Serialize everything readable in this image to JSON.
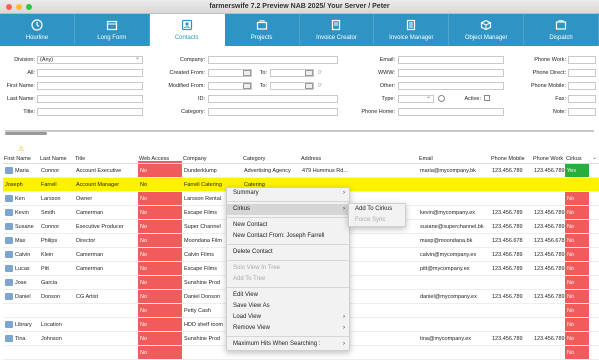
{
  "window": {
    "title": "farmerswife 7.2  Preview NAB 2025/ Your Server / Peter"
  },
  "toolbar": [
    {
      "label": "Hourline",
      "icon": "clock-icon",
      "active": false
    },
    {
      "label": "Long Form",
      "icon": "calendar-icon",
      "active": false
    },
    {
      "label": "Contacts",
      "icon": "contacts-icon",
      "active": true
    },
    {
      "label": "Projects",
      "icon": "briefcase-icon",
      "active": false
    },
    {
      "label": "Invoice Creator",
      "icon": "invoice-icon",
      "active": false
    },
    {
      "label": "Invoice Manager",
      "icon": "invoice-list-icon",
      "active": false
    },
    {
      "label": "Object Manager",
      "icon": "cube-icon",
      "active": false
    },
    {
      "label": "Dispatch",
      "icon": "dispatch-icon",
      "active": false
    }
  ],
  "search": {
    "division_label": "Division:",
    "division_value": "(Any)",
    "all_label": "All:",
    "firstname_label": "First Name:",
    "lastname_label": "Last Name:",
    "title_label": "Title:",
    "company_label": "Company:",
    "created_from_label": "Created From:",
    "to_label": "To:",
    "modified_from_label": "Modified From:",
    "id_label": "ID:",
    "category_label": "Category:",
    "email_label": "Email:",
    "www_label": "WWW:",
    "other_label": "Other:",
    "type_label": "Type:",
    "active_label": "Active:",
    "phone_home_label": "Phone Home:",
    "phone_work_label": "Phone Work:",
    "phone_direct_label": "Phone Direct:",
    "phone_mobile_label": "Phone Mobile:",
    "fax_label": "Fax:",
    "note_label": "Note:",
    "date_hint": "0'"
  },
  "table": {
    "columns": [
      "First Name",
      "Last Name",
      "Title",
      "Web Access",
      "Company",
      "Category",
      "Address",
      "Email",
      "Phone Mobile",
      "Phone Work",
      "Cirkus"
    ],
    "rows": [
      {
        "first": "Maria",
        "last": "Connor",
        "title": "Account Executive",
        "web": "No",
        "company": "Dunderklump",
        "category": "Advertising Agency",
        "address": "479 Hummus Rd...",
        "email": "maria@mycompany.bk",
        "mobile": "123.456.789",
        "work": "123.456.789",
        "cirkus": "Yes",
        "selected": false
      },
      {
        "first": "Joseph",
        "last": "Farrell",
        "title": "Account Manager",
        "web": "No",
        "company": "Farrell Catering",
        "category": "Catering",
        "address": "",
        "email": "",
        "mobile": "",
        "work": "",
        "cirkus": "",
        "selected": true
      },
      {
        "first": "Ken",
        "last": "Larsson",
        "title": "Owner",
        "web": "No",
        "company": "Larsson Rental",
        "category": "",
        "address": "",
        "email": "",
        "mobile": "",
        "work": "",
        "cirkus": "No",
        "selected": false
      },
      {
        "first": "Kevin",
        "last": "Smith",
        "title": "Camerman",
        "web": "No",
        "company": "Escape Films",
        "category": "",
        "address": "",
        "email": "kevin@mycompany.ex",
        "mobile": "123.456.789",
        "work": "123.456.789",
        "cirkus": "No",
        "selected": false
      },
      {
        "first": "Susane",
        "last": "Connor",
        "title": "Executive Producer",
        "web": "No",
        "company": "Super Channel",
        "category": "",
        "address": "",
        "email": "susane@superchannel.bk",
        "mobile": "123.456.789",
        "work": "123.456.789",
        "cirkus": "No",
        "selected": false
      },
      {
        "first": "Max",
        "last": "Philips",
        "title": "Director",
        "web": "No",
        "company": "Moondana Film",
        "category": "",
        "address": "",
        "email": "maxp@moondana.bk",
        "mobile": "123.456.678",
        "work": "123.456.678",
        "cirkus": "No",
        "selected": false
      },
      {
        "first": "Calvin",
        "last": "Klein",
        "title": "Camerman",
        "web": "No",
        "company": "Calvin Films",
        "category": "",
        "address": "",
        "email": "calvin@mycompany.ex",
        "mobile": "123.456.789",
        "work": "123.456.789",
        "cirkus": "No",
        "selected": false
      },
      {
        "first": "Lucas",
        "last": "Pitt",
        "title": "Camerman",
        "web": "No",
        "company": "Escape Films",
        "category": "",
        "address": "",
        "email": "pitt@mycompany.ex",
        "mobile": "123.456.789",
        "work": "123.456.789",
        "cirkus": "No",
        "selected": false
      },
      {
        "first": "Jose",
        "last": "Garcia",
        "title": "",
        "web": "No",
        "company": "Sunshine Prod",
        "category": "",
        "address": "",
        "email": "",
        "mobile": "",
        "work": "",
        "cirkus": "No",
        "selected": false
      },
      {
        "first": "Daniel",
        "last": "Donson",
        "title": "CG Artist",
        "web": "No",
        "company": "Daniel Donson",
        "category": "",
        "address": "",
        "email": "daniel@mycompany.ex",
        "mobile": "123.456.789",
        "work": "123.456.789",
        "cirkus": "No",
        "selected": false
      },
      {
        "first": "",
        "last": "",
        "title": "",
        "web": "No",
        "company": "Petty Cash",
        "category": "",
        "address": "",
        "email": "",
        "mobile": "",
        "work": "",
        "cirkus": "No",
        "selected": false
      },
      {
        "first": "Library",
        "last": "Location",
        "title": "",
        "web": "No",
        "company": "HDD shelf room",
        "category": "",
        "address": "",
        "email": "",
        "mobile": "",
        "work": "",
        "cirkus": "No",
        "selected": false
      },
      {
        "first": "Tina",
        "last": "Johnson",
        "title": "",
        "web": "No",
        "company": "Sunshine Prod",
        "category": "",
        "address": "",
        "email": "tina@mycompany.ex",
        "mobile": "123.456.789",
        "work": "123.456.789",
        "cirkus": "No",
        "selected": false
      },
      {
        "first": "",
        "last": "",
        "title": "",
        "web": "No",
        "company": "",
        "category": "",
        "address": "",
        "email": "",
        "mobile": "",
        "work": "",
        "cirkus": "No",
        "selected": false
      }
    ]
  },
  "context_menu": [
    {
      "label": "Summary",
      "submenu": true,
      "disabled": false,
      "highlight": false
    },
    {
      "sep": true
    },
    {
      "label": "Cirkus",
      "submenu": true,
      "disabled": false,
      "highlight": true
    },
    {
      "sep": true
    },
    {
      "label": "New Contact",
      "submenu": false,
      "disabled": false
    },
    {
      "label": "New Contact From: Joseph Farrell",
      "submenu": false,
      "disabled": false
    },
    {
      "sep": true
    },
    {
      "label": "Delete Contact",
      "submenu": false,
      "disabled": false
    },
    {
      "sep": true
    },
    {
      "label": "Solo View In Tree",
      "submenu": false,
      "disabled": true
    },
    {
      "label": "Add To Tree",
      "submenu": false,
      "disabled": true
    },
    {
      "sep": true
    },
    {
      "label": "Edit View",
      "submenu": false,
      "disabled": false
    },
    {
      "label": "Save View As",
      "submenu": false,
      "disabled": false
    },
    {
      "label": "Load View",
      "submenu": true,
      "disabled": false
    },
    {
      "label": "Remove View",
      "submenu": true,
      "disabled": false
    },
    {
      "sep": true
    },
    {
      "label": "Maximum Hits When Searching :",
      "submenu": true,
      "disabled": false
    }
  ],
  "submenu": [
    {
      "label": "Add To Cirkus",
      "disabled": false
    },
    {
      "label": "Force Sync",
      "disabled": true
    }
  ],
  "colors": {
    "toolbar": "#2f94c4",
    "selected_row": "#fff200",
    "no_cell": "#f15b5b",
    "yes_cell": "#27ae3c"
  }
}
